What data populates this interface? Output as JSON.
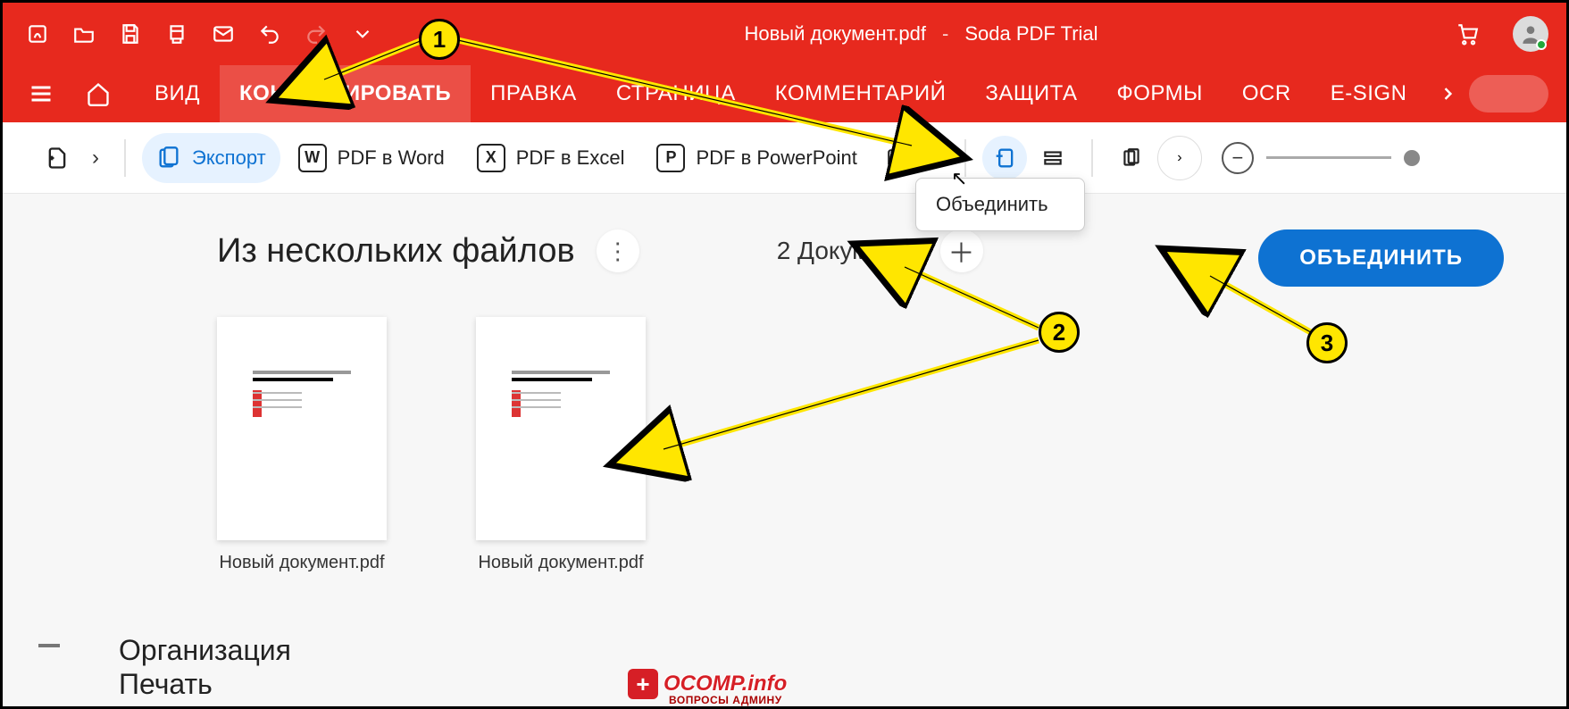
{
  "app": {
    "doc_title": "Новый документ.pdf",
    "sep": "-",
    "product": "Soda PDF Trial"
  },
  "tabs": {
    "vid": "ВИД",
    "konvert": "КОНВЕРТИРОВАТЬ",
    "pravka": "ПРАВКА",
    "stranica": "СТРАНИЦА",
    "komment": "КОММЕНТАРИЙ",
    "zashchita": "ЗАЩИТА",
    "formy": "ФОРМЫ",
    "ocr": "OCR",
    "esign": "E-SIGN"
  },
  "ribbon": {
    "export": "Экспорт",
    "to_word": "PDF в Word",
    "to_excel": "PDF в Excel",
    "to_ppt": "PDF в PowerPoint",
    "w": "W",
    "x": "X",
    "p": "P"
  },
  "tooltip": {
    "merge": "Объединить"
  },
  "main": {
    "title": "Из нескольких файлов",
    "doc_count": "2 Документа",
    "merge_btn": "ОБЪЕДИНИТЬ",
    "files": [
      {
        "name": "Новый документ.pdf"
      },
      {
        "name": "Новый документ.pdf"
      }
    ]
  },
  "annotations": {
    "n1": "1",
    "n2": "2",
    "n3": "3"
  },
  "bottom": {
    "org": "Организация",
    "pechat": "Печать"
  },
  "badge": {
    "main": "OCOMP.info",
    "sub": "ВОПРОСЫ АДМИНУ"
  }
}
